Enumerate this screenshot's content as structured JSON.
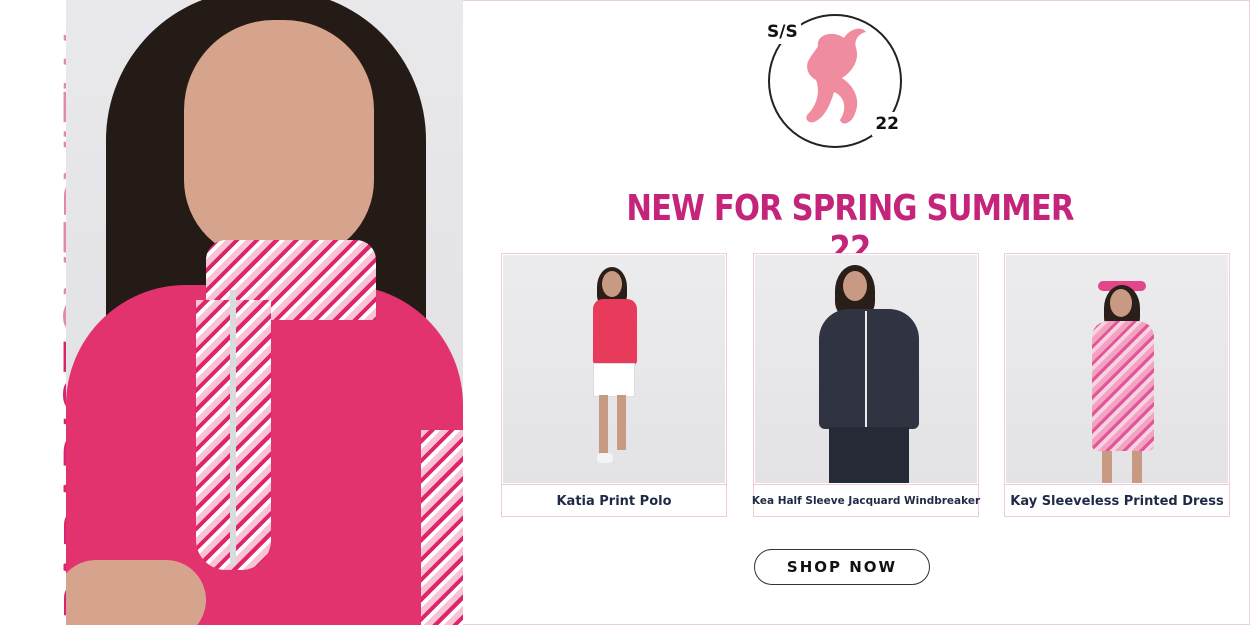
{
  "brand": {
    "vertical_word_1": "PARADISE",
    "vertical_word_2": "OVERVIEW"
  },
  "logo": {
    "season": "S/S",
    "year": "22"
  },
  "headline": "NEW FOR SPRING SUMMER 22",
  "products": [
    {
      "name": "Katia Print Polo"
    },
    {
      "name": "Kea Half Sleeve Jacquard Windbreaker"
    },
    {
      "name": "Kay Sleeveless Printed Dress"
    }
  ],
  "cta": {
    "label": "SHOP NOW"
  },
  "colors": {
    "accent_pink": "#c4247a",
    "vertical_dark_pink": "#d6246e",
    "vertical_light_pink": "#e08aa8",
    "logo_horse": "#f08ca0",
    "card_border": "#f3cbd8",
    "product_text": "#1f2b44"
  }
}
